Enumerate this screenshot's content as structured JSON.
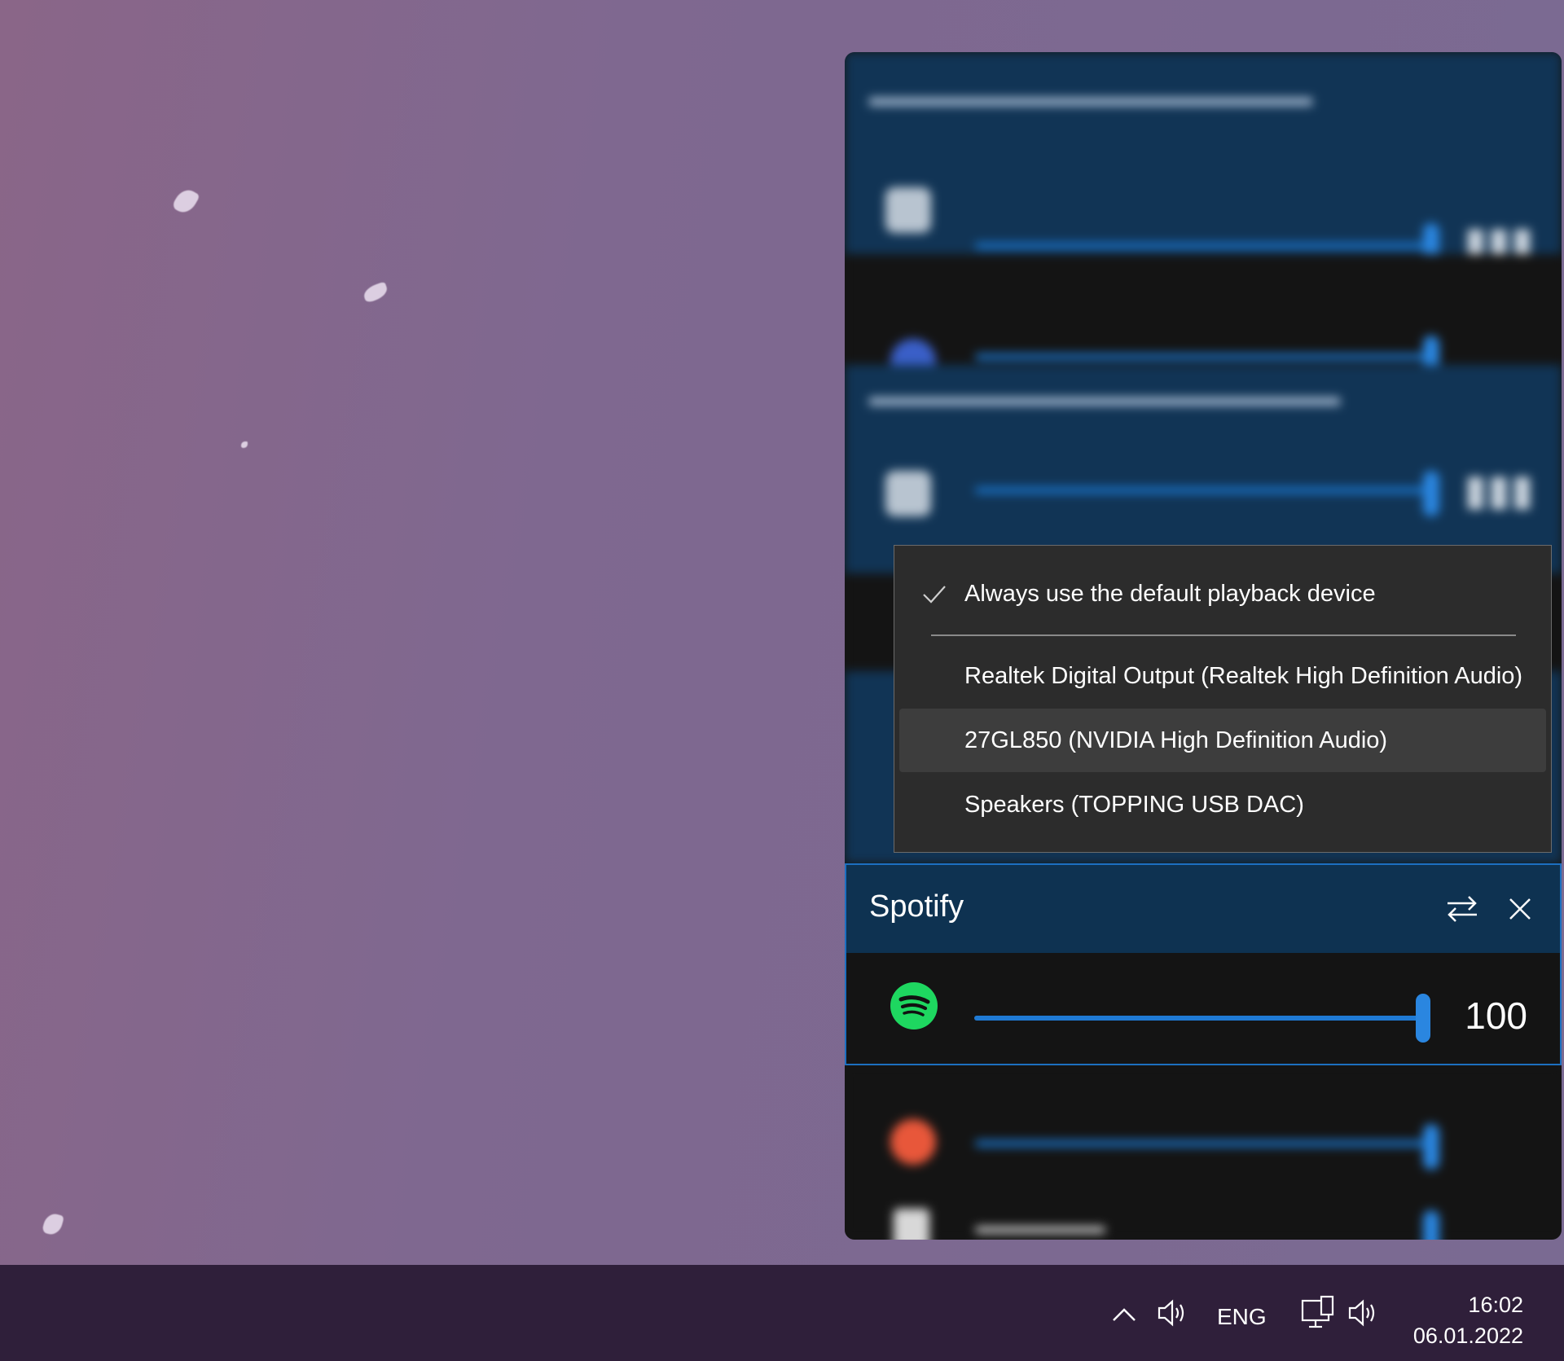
{
  "menu": {
    "items": [
      {
        "label": "Always use the default playback device",
        "checked": true
      },
      {
        "label": "Realtek Digital Output (Realtek High Definition Audio)",
        "checked": false
      },
      {
        "label": "27GL850 (NVIDIA High Definition Audio)",
        "checked": false,
        "highlighted": true
      },
      {
        "label": "Speakers (TOPPING USB DAC)",
        "checked": false
      }
    ]
  },
  "session": {
    "title": "Spotify",
    "volume": "100",
    "volume_fraction": 1.0,
    "icon": "spotify-icon",
    "buttons": [
      "switch-device-icon",
      "close-icon"
    ]
  },
  "taskbar": {
    "language": "ENG",
    "time": "16:02",
    "date": "06.01.2022",
    "icons": [
      "chevron-up-icon",
      "speaker-icon",
      "network-icon",
      "speaker-icon"
    ]
  },
  "colors": {
    "accent": "#1f7ad4",
    "device_header": "#113455",
    "spotify_green": "#1ed760",
    "taskbar": "#2f1f3a"
  }
}
